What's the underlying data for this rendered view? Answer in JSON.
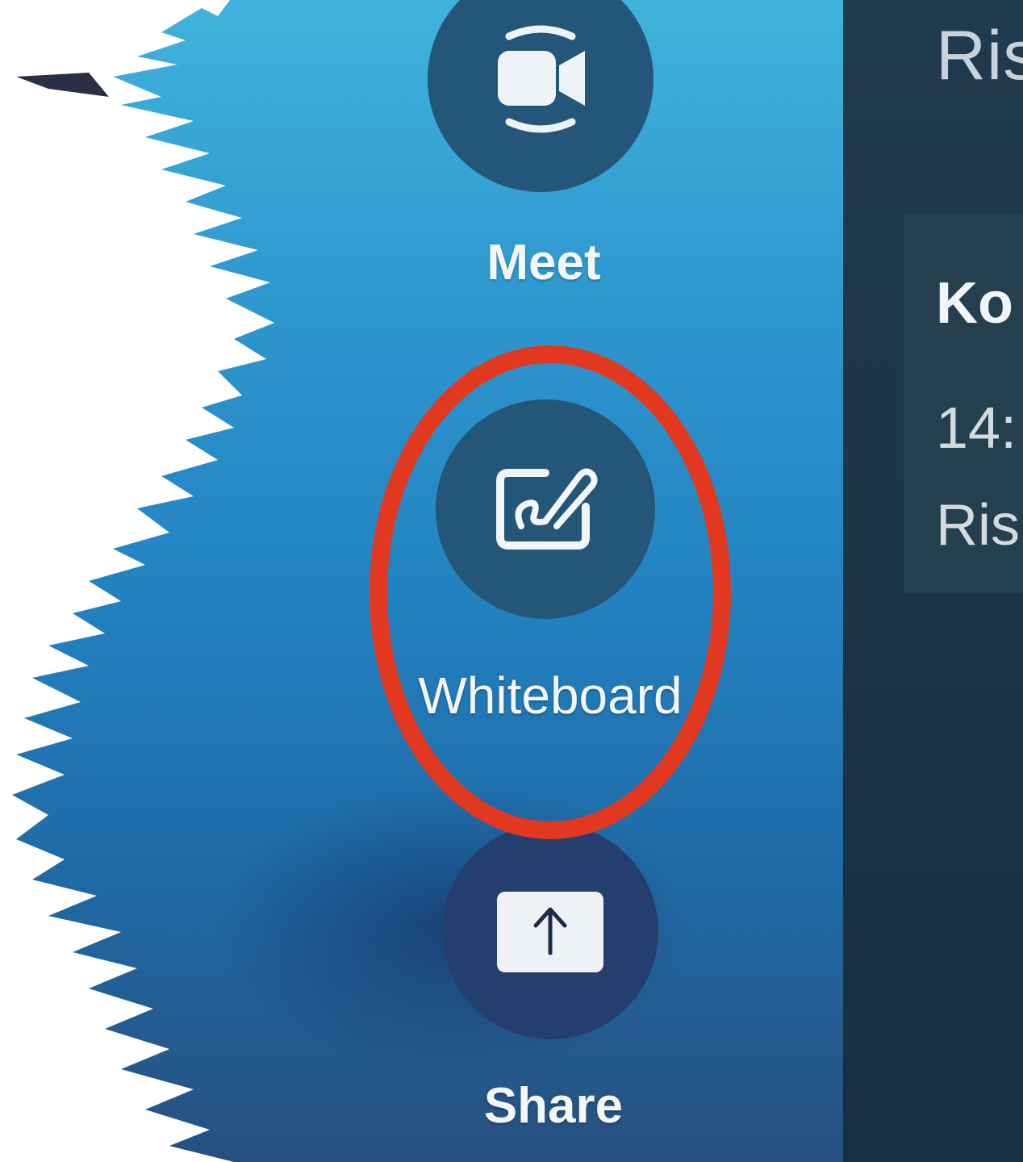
{
  "actions": {
    "meet": {
      "label": "Meet",
      "icon": "video-camera-icon"
    },
    "whiteboard": {
      "label": "Whiteboard",
      "icon": "whiteboard-pen-icon"
    },
    "share": {
      "label": "Share",
      "icon": "share-upload-icon"
    }
  },
  "right_panel": {
    "top_text": "Ris",
    "meeting": {
      "title": "Ko",
      "time": "14:",
      "room": "Ris"
    }
  },
  "highlight": {
    "target": "whiteboard",
    "color": "#e2381f"
  },
  "colors": {
    "button_circle": "#245679",
    "background_top": "#3fb3dc",
    "background_bottom": "#27507f",
    "panel": "#203a4e"
  }
}
